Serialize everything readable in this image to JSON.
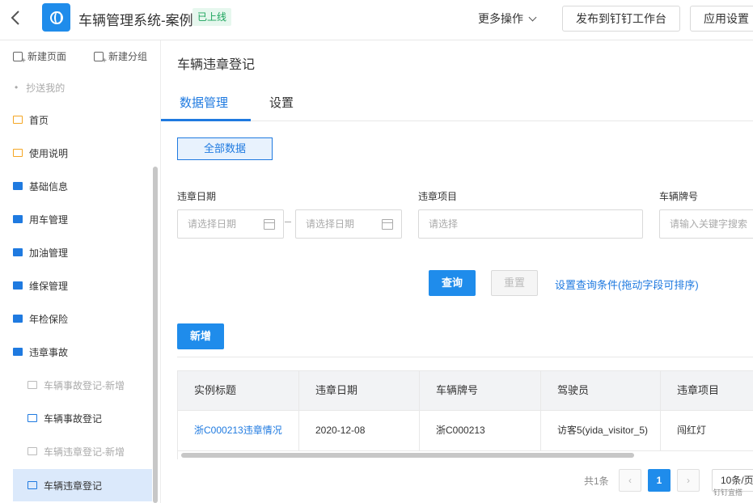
{
  "header": {
    "back_icon": "chevron-left-icon",
    "app_icon": "globe-icon",
    "app_title": "车辆管理系统-案例",
    "status_badge": "已上线",
    "more_ops": "更多操作",
    "publish_button": "发布到钉钉工作台",
    "app_settings_button": "应用设置"
  },
  "sidebar": {
    "new_page": "新建页面",
    "new_group": "新建分组",
    "cc_me": "抄送我的",
    "items": [
      {
        "label": "首页",
        "icon": "page-icon",
        "state": "normal"
      },
      {
        "label": "使用说明",
        "icon": "page-icon",
        "state": "normal"
      },
      {
        "label": "基础信息",
        "icon": "folder-icon",
        "state": "normal"
      },
      {
        "label": "用车管理",
        "icon": "folder-icon",
        "state": "normal"
      },
      {
        "label": "加油管理",
        "icon": "folder-icon",
        "state": "normal"
      },
      {
        "label": "维保管理",
        "icon": "folder-icon",
        "state": "normal"
      },
      {
        "label": "年检保险",
        "icon": "folder-icon",
        "state": "normal"
      },
      {
        "label": "违章事故",
        "icon": "folder-open-icon",
        "state": "normal"
      },
      {
        "label": "车辆事故登记-新增",
        "icon": "doc-icon",
        "state": "disabled"
      },
      {
        "label": "车辆事故登记",
        "icon": "form-icon",
        "state": "normal"
      },
      {
        "label": "车辆违章登记-新增",
        "icon": "doc-icon",
        "state": "disabled"
      },
      {
        "label": "车辆违章登记",
        "icon": "form-icon",
        "state": "active"
      }
    ]
  },
  "main": {
    "page_title": "车辆违章登记",
    "tabs": [
      "数据管理",
      "设置"
    ],
    "active_tab": "数据管理",
    "all_data_button": "全部数据",
    "filters": {
      "date_label": "违章日期",
      "date_start_placeholder": "请选择日期",
      "date_end_placeholder": "请选择日期",
      "item_label": "违章项目",
      "item_placeholder": "请选择",
      "plate_label": "车辆牌号",
      "plate_placeholder": "请输入关键字搜索"
    },
    "query_button": "查询",
    "reset_button": "重置",
    "set_query_link": "设置查询条件(拖动字段可排序)",
    "add_button": "新增",
    "table": {
      "columns": [
        "实例标题",
        "违章日期",
        "车辆牌号",
        "驾驶员",
        "违章项目"
      ],
      "rows": [
        [
          "浙C000213违章情况",
          "2020-12-08",
          "浙C000213",
          "访客5(yida_visitor_5)",
          "闯红灯"
        ]
      ]
    },
    "pagination": {
      "total": "共1条",
      "prev": "‹",
      "current": "1",
      "next": "›",
      "page_size": "10条/页"
    },
    "watermark": "钉钉宜搭"
  },
  "colors": {
    "primary": "#1f8ceb",
    "link": "#1f7ae0",
    "badge_green": "#1aa35b",
    "active_bg": "#dbe9fb"
  }
}
